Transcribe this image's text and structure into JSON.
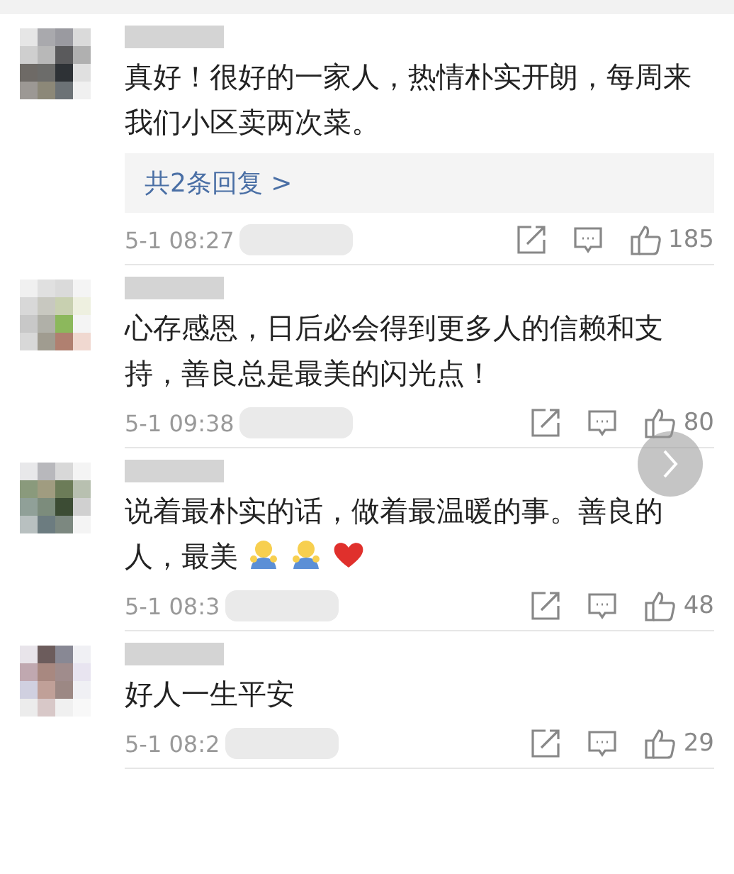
{
  "comments": [
    {
      "text": "真好！很好的一家人，热情朴实开朗，每周来我们小区卖两次菜。",
      "replies": "共2条回复 >",
      "time": "5-1 08:27",
      "likes": "185"
    },
    {
      "text": "心存感恩，日后必会得到更多人的信赖和支持，善良总是最美的闪光点！",
      "time": "5-1 09:38",
      "likes": "80"
    },
    {
      "text": "说着最朴实的话，做着最温暖的事。善良的人，最美",
      "emojis": [
        {
          "kind": "hug"
        },
        {
          "kind": "hug"
        },
        {
          "kind": "heart"
        }
      ],
      "time": "5-1 08:3",
      "likes": "48"
    },
    {
      "text": "好人一生平安",
      "time": "5-1 08:2",
      "likes": "29"
    }
  ],
  "scroll_button": {
    "kind": "next"
  }
}
